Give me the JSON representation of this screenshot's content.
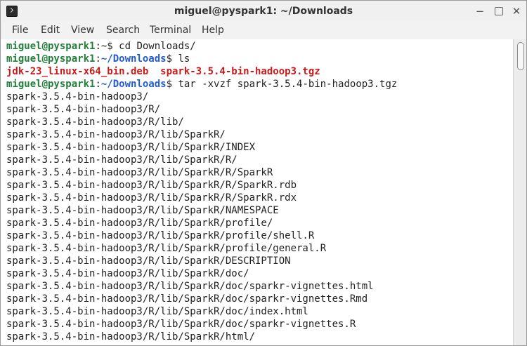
{
  "window": {
    "title": "miguel@pyspark1: ~/Downloads",
    "buttons": [
      "−",
      "",
      "✕"
    ]
  },
  "menu": [
    "File",
    "Edit",
    "View",
    "Search",
    "Terminal",
    "Help"
  ],
  "terminal": {
    "lines": [
      [
        {
          "text": "miguel@pyspark1",
          "cls": "prompt"
        },
        {
          "text": ":~$ cd Downloads/",
          "cls": ""
        }
      ],
      [
        {
          "text": "miguel@pyspark1",
          "cls": "prompt"
        },
        {
          "text": ":",
          "cls": ""
        },
        {
          "text": "~/Downloads",
          "cls": "path"
        },
        {
          "text": "$ ls",
          "cls": ""
        }
      ],
      [
        {
          "text": "jdk-23_linux-x64_bin.deb  spark-3.5.4-bin-hadoop3.tgz",
          "cls": "red"
        }
      ],
      [
        {
          "text": "miguel@pyspark1",
          "cls": "prompt"
        },
        {
          "text": ":",
          "cls": ""
        },
        {
          "text": "~/Downloads",
          "cls": "path"
        },
        {
          "text": "$ tar -xvzf spark-3.5.4-bin-hadoop3.tgz",
          "cls": ""
        }
      ],
      [
        {
          "text": "spark-3.5.4-bin-hadoop3/",
          "cls": ""
        }
      ],
      [
        {
          "text": "spark-3.5.4-bin-hadoop3/R/",
          "cls": ""
        }
      ],
      [
        {
          "text": "spark-3.5.4-bin-hadoop3/R/lib/",
          "cls": ""
        }
      ],
      [
        {
          "text": "spark-3.5.4-bin-hadoop3/R/lib/SparkR/",
          "cls": ""
        }
      ],
      [
        {
          "text": "spark-3.5.4-bin-hadoop3/R/lib/SparkR/INDEX",
          "cls": ""
        }
      ],
      [
        {
          "text": "spark-3.5.4-bin-hadoop3/R/lib/SparkR/R/",
          "cls": ""
        }
      ],
      [
        {
          "text": "spark-3.5.4-bin-hadoop3/R/lib/SparkR/R/SparkR",
          "cls": ""
        }
      ],
      [
        {
          "text": "spark-3.5.4-bin-hadoop3/R/lib/SparkR/R/SparkR.rdb",
          "cls": ""
        }
      ],
      [
        {
          "text": "spark-3.5.4-bin-hadoop3/R/lib/SparkR/R/SparkR.rdx",
          "cls": ""
        }
      ],
      [
        {
          "text": "spark-3.5.4-bin-hadoop3/R/lib/SparkR/NAMESPACE",
          "cls": ""
        }
      ],
      [
        {
          "text": "spark-3.5.4-bin-hadoop3/R/lib/SparkR/profile/",
          "cls": ""
        }
      ],
      [
        {
          "text": "spark-3.5.4-bin-hadoop3/R/lib/SparkR/profile/shell.R",
          "cls": ""
        }
      ],
      [
        {
          "text": "spark-3.5.4-bin-hadoop3/R/lib/SparkR/profile/general.R",
          "cls": ""
        }
      ],
      [
        {
          "text": "spark-3.5.4-bin-hadoop3/R/lib/SparkR/DESCRIPTION",
          "cls": ""
        }
      ],
      [
        {
          "text": "spark-3.5.4-bin-hadoop3/R/lib/SparkR/doc/",
          "cls": ""
        }
      ],
      [
        {
          "text": "spark-3.5.4-bin-hadoop3/R/lib/SparkR/doc/sparkr-vignettes.html",
          "cls": ""
        }
      ],
      [
        {
          "text": "spark-3.5.4-bin-hadoop3/R/lib/SparkR/doc/sparkr-vignettes.Rmd",
          "cls": ""
        }
      ],
      [
        {
          "text": "spark-3.5.4-bin-hadoop3/R/lib/SparkR/doc/index.html",
          "cls": ""
        }
      ],
      [
        {
          "text": "spark-3.5.4-bin-hadoop3/R/lib/SparkR/doc/sparkr-vignettes.R",
          "cls": ""
        }
      ],
      [
        {
          "text": "spark-3.5.4-bin-hadoop3/R/lib/SparkR/html/",
          "cls": ""
        }
      ]
    ]
  },
  "colors": {
    "prompt": "#22803a",
    "path": "#225bd0",
    "archive": "#c81b1b",
    "terminal_bg": "#ffffff"
  }
}
